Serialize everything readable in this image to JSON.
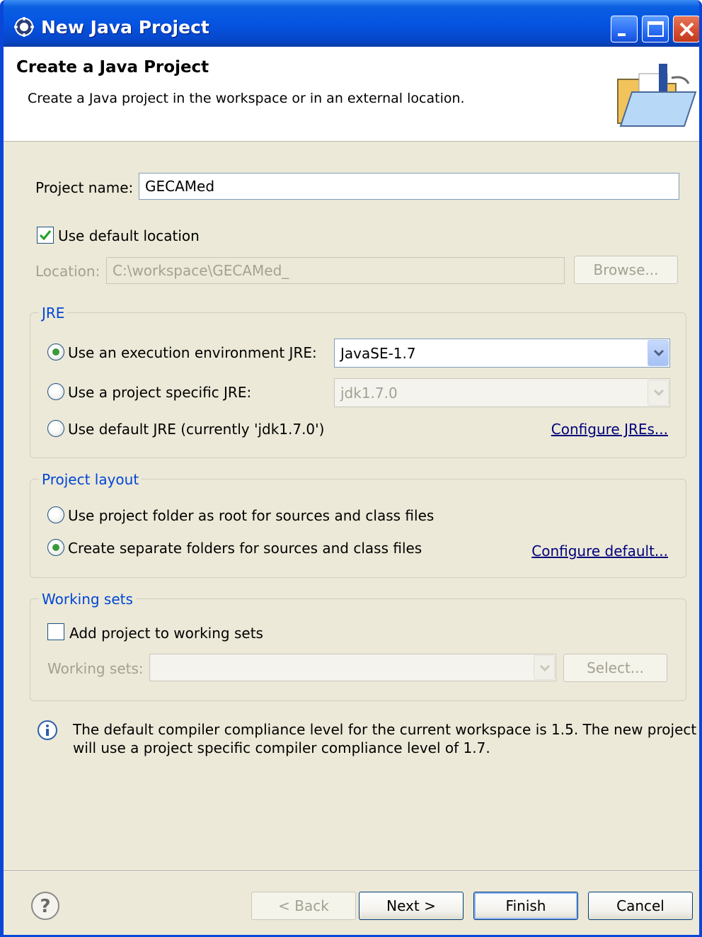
{
  "window": {
    "title": "New Java Project"
  },
  "banner": {
    "title": "Create a Java Project",
    "description": "Create a Java project in the workspace or in an external location."
  },
  "project": {
    "name_label": "Project name:",
    "name_value": "GECAMed"
  },
  "location": {
    "use_default_label": "Use default location",
    "use_default_checked": true,
    "label": "Location:",
    "value": "C:\\workspace\\GECAMed_",
    "browse_label": "Browse..."
  },
  "jre": {
    "group_title": "JRE",
    "options": [
      {
        "label": "Use an execution environment JRE:",
        "selected": true
      },
      {
        "label": "Use a project specific JRE:",
        "selected": false
      },
      {
        "label": "Use default JRE (currently 'jdk1.7.0')",
        "selected": false
      }
    ],
    "exec_env_value": "JavaSE-1.7",
    "specific_value": "jdk1.7.0",
    "configure_link": "Configure JREs..."
  },
  "layout": {
    "group_title": "Project layout",
    "options": [
      {
        "label": "Use project folder as root for sources and class files",
        "selected": false
      },
      {
        "label": "Create separate folders for sources and class files",
        "selected": true
      }
    ],
    "configure_link": "Configure default..."
  },
  "working_sets": {
    "group_title": "Working sets",
    "add_label": "Add project to working sets",
    "add_checked": false,
    "label": "Working sets:",
    "value": "",
    "select_label": "Select..."
  },
  "info": {
    "line1": "The default compiler compliance level for the current workspace is 1.5. The new project",
    "line2": "will use a project specific compiler compliance level of 1.7."
  },
  "buttons": {
    "back": "< Back",
    "next": "Next >",
    "finish": "Finish",
    "cancel": "Cancel"
  },
  "icons": {
    "title": "eclipse-gear-icon",
    "banner": "java-project-folder-icon",
    "info": "info-icon",
    "help": "help-icon",
    "minimize": "minimize-icon",
    "maximize": "maximize-icon",
    "close": "close-icon"
  }
}
